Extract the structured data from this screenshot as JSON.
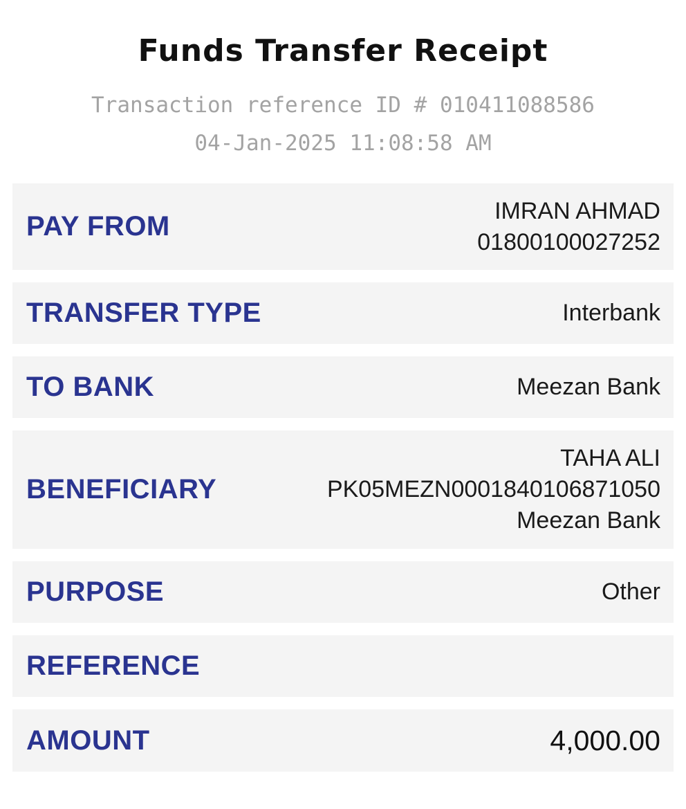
{
  "receipt": {
    "title": "Funds Transfer Receipt",
    "reference_line": "Transaction reference ID # 010411088586",
    "datetime": "04-Jan-2025 11:08:58 AM"
  },
  "rows": {
    "pay_from": {
      "label": "PAY FROM",
      "name": "IMRAN AHMAD",
      "account": "01800100027252"
    },
    "transfer_type": {
      "label": "TRANSFER TYPE",
      "value": "Interbank"
    },
    "to_bank": {
      "label": "TO BANK",
      "value": "Meezan Bank"
    },
    "beneficiary": {
      "label": "BENEFICIARY",
      "name": "TAHA ALI",
      "iban": "PK05MEZN0001840106871050",
      "bank": "Meezan Bank"
    },
    "purpose": {
      "label": "PURPOSE",
      "value": "Other"
    },
    "reference": {
      "label": "REFERENCE",
      "value": ""
    },
    "amount": {
      "label": "AMOUNT",
      "value": "4,000.00"
    }
  },
  "colors": {
    "label": "#2a3490",
    "row_background": "#f4f4f4",
    "subtitle": "#a3a3a3",
    "title": "#111111"
  }
}
